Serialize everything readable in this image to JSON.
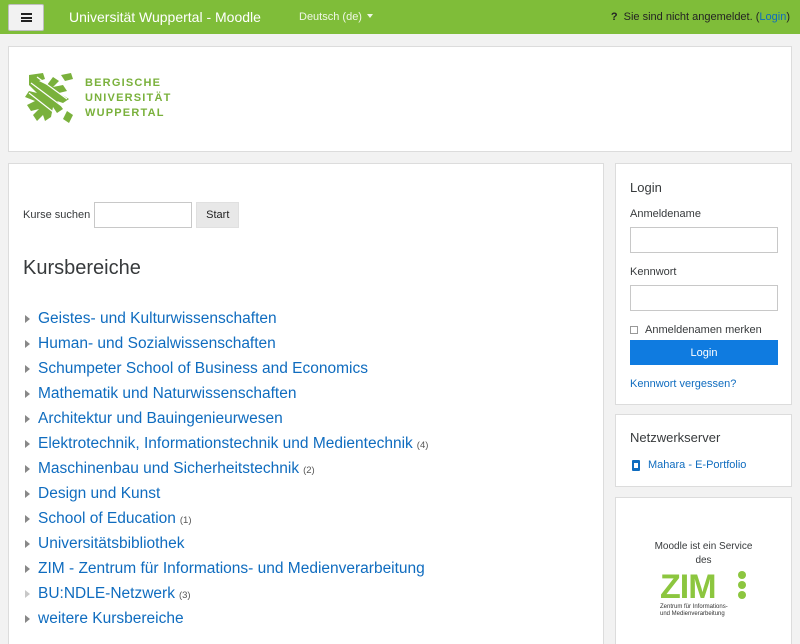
{
  "navbar": {
    "site_name": "Universität Wuppertal - Moodle",
    "language": "Deutsch (de)",
    "login_status": "Sie sind nicht angemeldet.",
    "login_link": "Login",
    "brand_color": "#7fbd39"
  },
  "header": {
    "logo_line1": "BERGISCHE",
    "logo_line2": "UNIVERSITÄT",
    "logo_line3": "WUPPERTAL"
  },
  "main": {
    "search_label": "Kurse suchen",
    "search_value": "",
    "start_label": "Start",
    "section_title": "Kursbereiche",
    "categories": [
      {
        "label": "Geistes- und Kulturwissenschaften",
        "count": ""
      },
      {
        "label": "Human- und Sozialwissenschaften",
        "count": ""
      },
      {
        "label": "Schumpeter School of Business and Economics",
        "count": ""
      },
      {
        "label": "Mathematik und Naturwissenschaften",
        "count": ""
      },
      {
        "label": "Architektur und Bauingenieurwesen",
        "count": ""
      },
      {
        "label": "Elektrotechnik, Informationstechnik und Medientechnik",
        "count": "(4)"
      },
      {
        "label": "Maschinenbau und Sicherheitstechnik",
        "count": "(2)"
      },
      {
        "label": "Design und Kunst",
        "count": ""
      },
      {
        "label": "School of Education",
        "count": "(1)"
      },
      {
        "label": "Universitätsbibliothek",
        "count": ""
      },
      {
        "label": "ZIM - Zentrum für Informations- und Medienverarbeitung",
        "count": ""
      },
      {
        "label": "BU:NDLE-Netzwerk",
        "count": "(3)"
      },
      {
        "label": "weitere Kursbereiche",
        "count": ""
      }
    ]
  },
  "login_block": {
    "title": "Login",
    "username_label": "Anmeldename",
    "username_value": "",
    "password_label": "Kennwort",
    "password_value": "",
    "remember_label": "Anmeldenamen merken",
    "remember_checked": false,
    "submit_label": "Login",
    "forgot_label": "Kennwort vergessen?",
    "button_color": "#0f7be0"
  },
  "network_block": {
    "title": "Netzwerkserver",
    "link_label": "Mahara - E-Portfolio"
  },
  "zim_block": {
    "text_line1": "Moodle ist ein Service",
    "text_line2": "des",
    "logo_word": "ZIM",
    "logo_sub1": "Zentrum für Informations-",
    "logo_sub2": "und Medienverarbeitung"
  }
}
